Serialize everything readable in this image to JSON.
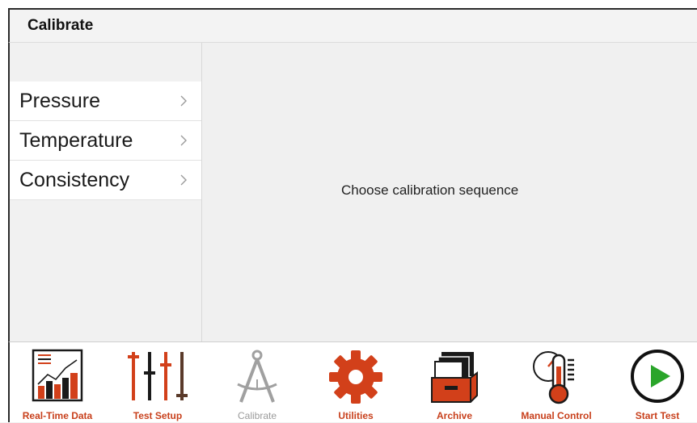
{
  "header": {
    "title": "Calibrate"
  },
  "sidebar": {
    "items": [
      {
        "label": "Pressure"
      },
      {
        "label": "Temperature"
      },
      {
        "label": "Consistency"
      }
    ]
  },
  "main": {
    "message": "Choose calibration sequence"
  },
  "toolbar": {
    "items": [
      {
        "label": "Real-Time Data",
        "icon": "chart-icon"
      },
      {
        "label": "Test Setup",
        "icon": "sliders-icon"
      },
      {
        "label": "Calibrate",
        "icon": "compass-icon",
        "active": true
      },
      {
        "label": "Utilities",
        "icon": "gear-icon"
      },
      {
        "label": "Archive",
        "icon": "archive-box-icon"
      },
      {
        "label": "Manual Control",
        "icon": "thermometer-gauge-icon"
      },
      {
        "label": "Start Test",
        "icon": "play-icon"
      }
    ]
  },
  "colors": {
    "accent": "#d2401a",
    "dark": "#1a1a1a",
    "inactive": "#9a9a9a"
  }
}
